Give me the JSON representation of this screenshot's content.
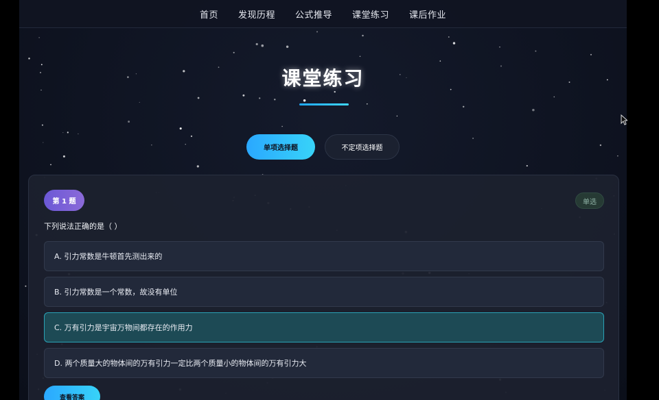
{
  "nav": {
    "items": [
      "首页",
      "发现历程",
      "公式推导",
      "课堂练习",
      "课后作业"
    ]
  },
  "page": {
    "title": "课堂练习"
  },
  "tabs": [
    {
      "label": "单项选择题",
      "active": true
    },
    {
      "label": "不定项选择题",
      "active": false
    }
  ],
  "question": {
    "number_label": "第 1 题",
    "type_label": "单选",
    "text": "下列说法正确的是（ ）",
    "options": [
      {
        "label": "A. 引力常数是牛顿首先测出来的",
        "selected": false
      },
      {
        "label": "B. 引力常数是一个常数，故没有单位",
        "selected": false
      },
      {
        "label": "C. 万有引力是宇宙万物间都存在的作用力",
        "selected": true
      },
      {
        "label": "D. 两个质量大的物体间的万有引力一定比两个质量小的物体间的万有引力大",
        "selected": false
      }
    ],
    "answer_button_label": "查看答案"
  },
  "colors": {
    "accent": "#2aa8ff",
    "accent_light": "#38d3f8",
    "badge_purple": "#6b58d6",
    "selected_option": "#1d4a55",
    "background": "#0f1422"
  }
}
